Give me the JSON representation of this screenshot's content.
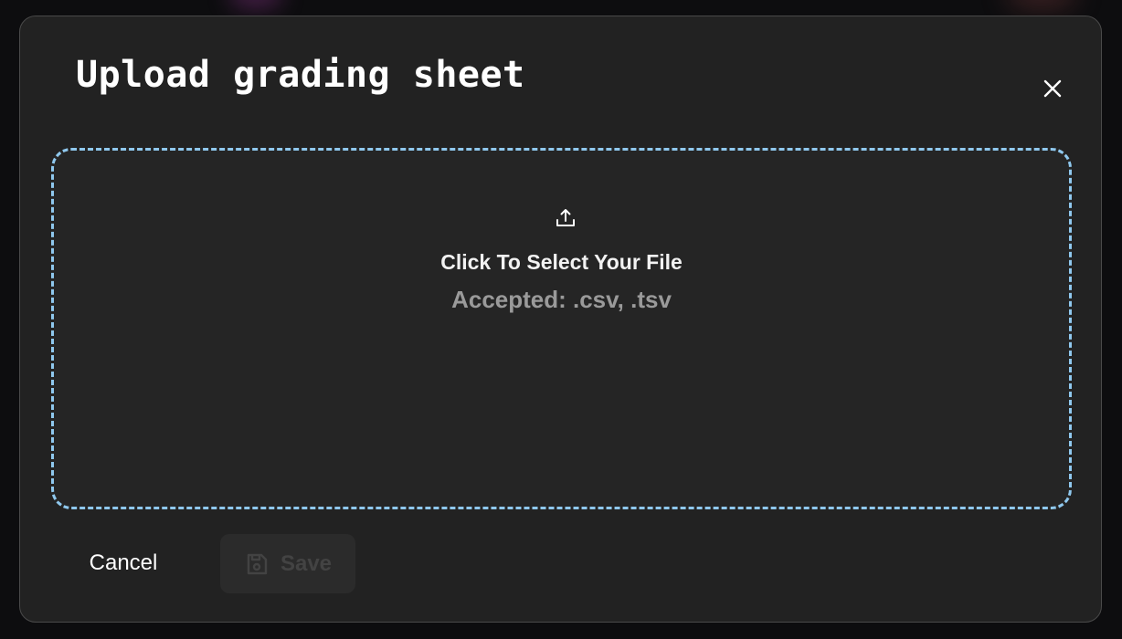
{
  "dialog": {
    "title": "Upload grading sheet",
    "close_icon": "close-icon"
  },
  "dropzone": {
    "icon": "upload-icon",
    "title": "Click To Select Your File",
    "accepted": "Accepted: .csv, .tsv",
    "border_color": "#8fc8ee"
  },
  "actions": {
    "cancel_label": "Cancel",
    "save_label": "Save",
    "save_icon": "save-icon",
    "save_disabled": true
  }
}
